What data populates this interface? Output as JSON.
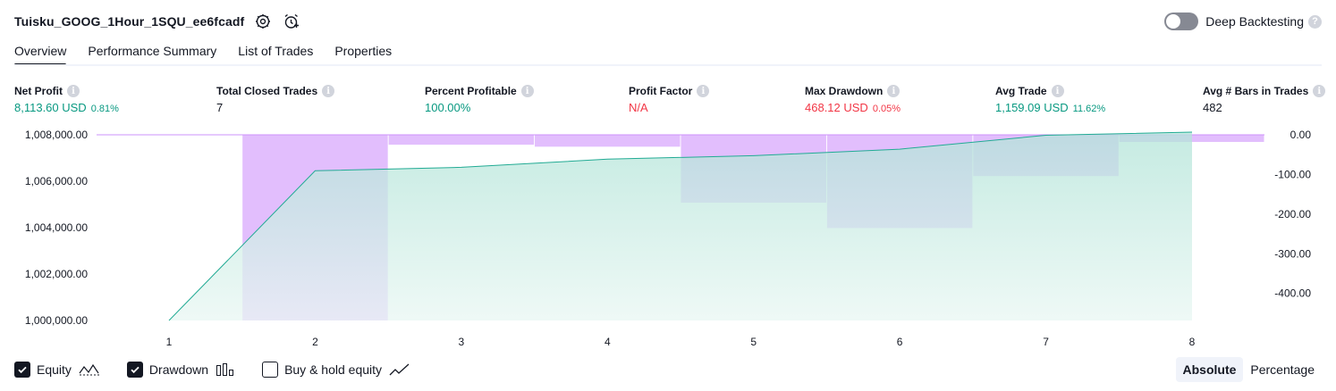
{
  "header": {
    "strategy_name": "Tuisku_GOOG_1Hour_1SQU_ee6fcadf",
    "icons": [
      "gear-icon",
      "alarm-add-icon"
    ],
    "deep_backtesting_label": "Deep Backtesting",
    "deep_backtesting_on": false
  },
  "tabs": [
    {
      "label": "Overview",
      "active": true
    },
    {
      "label": "Performance Summary",
      "active": false
    },
    {
      "label": "List of Trades",
      "active": false
    },
    {
      "label": "Properties",
      "active": false
    }
  ],
  "metrics": [
    {
      "title": "Net Profit",
      "value": "8,113.60 USD",
      "pct": "0.81%",
      "tone": "pos"
    },
    {
      "title": "Total Closed Trades",
      "value": "7",
      "pct": "",
      "tone": "plain"
    },
    {
      "title": "Percent Profitable",
      "value": "100.00%",
      "pct": "",
      "tone": "pos"
    },
    {
      "title": "Profit Factor",
      "value": "N/A",
      "pct": "",
      "tone": "neg"
    },
    {
      "title": "Max Drawdown",
      "value": "468.12 USD",
      "pct": "0.05%",
      "tone": "neg"
    },
    {
      "title": "Avg Trade",
      "value": "1,159.09 USD",
      "pct": "11.62%",
      "tone": "pos"
    },
    {
      "title": "Avg # Bars in Trades",
      "value": "482",
      "pct": "",
      "tone": "plain"
    }
  ],
  "colors": {
    "equity_line": "#22ab94",
    "equity_fill_top": "#b2e4d8",
    "equity_fill_bottom": "#e9f7f3",
    "drawdown": "#ce93fb",
    "positive": "#089981",
    "negative": "#f23645"
  },
  "chart_data": {
    "type": "area",
    "x": [
      1,
      2,
      3,
      4,
      5,
      6,
      7,
      8
    ],
    "series": [
      {
        "name": "Equity",
        "axis": "left",
        "values": [
          1000000,
          1006450,
          1006600,
          1006950,
          1007100,
          1007380,
          1007980,
          1008113.6
        ]
      },
      {
        "name": "Drawdown",
        "axis": "right",
        "kind": "bar",
        "values": [
          0,
          -468.12,
          -25,
          -30,
          -171,
          -235,
          -104,
          -18
        ]
      }
    ],
    "left_axis": {
      "ticks": [
        "1,008,000.00",
        "1,006,000.00",
        "1,004,000.00",
        "1,002,000.00",
        "1,000,000.00"
      ],
      "ylim": [
        1000000,
        1008000
      ]
    },
    "right_axis": {
      "ticks": [
        "0.00",
        "-100.00",
        "-200.00",
        "-300.00",
        "-400.00"
      ],
      "ylim": [
        -468.12,
        0
      ]
    },
    "x_ticks": [
      "1",
      "2",
      "3",
      "4",
      "5",
      "6",
      "7",
      "8"
    ],
    "grid": false
  },
  "footer": {
    "toggles": [
      {
        "label": "Equity",
        "checked": true,
        "icon": "equity-line-icon"
      },
      {
        "label": "Drawdown",
        "checked": true,
        "icon": "drawdown-bars-icon"
      },
      {
        "label": "Buy & hold equity",
        "checked": false,
        "icon": "buy-hold-line-icon"
      }
    ],
    "modes": [
      {
        "label": "Absolute",
        "active": true
      },
      {
        "label": "Percentage",
        "active": false
      }
    ]
  }
}
